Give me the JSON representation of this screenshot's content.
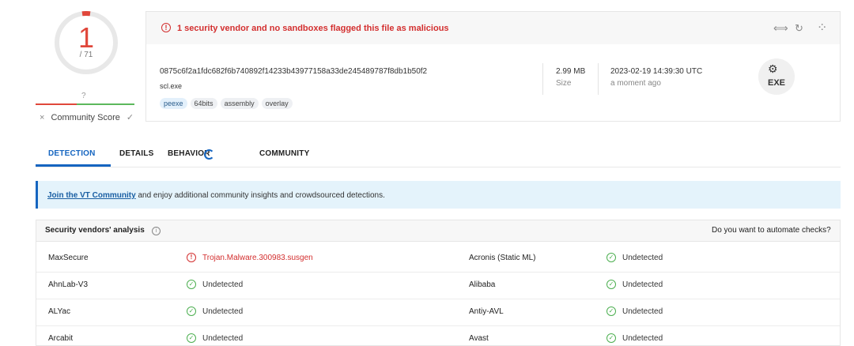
{
  "score": {
    "detections": "1",
    "total": "/ 71",
    "unknown": "?",
    "community_label": "Community Score",
    "x_icon": "×",
    "check_icon": "✓"
  },
  "alert": {
    "text": "1 security vendor and no sandboxes flagged this file as malicious",
    "icon": "!"
  },
  "toolbar": {
    "compare_icon": "⟺",
    "reanalyze_icon": "↻",
    "graph_icon": "⁘"
  },
  "file": {
    "hash": "0875c6f2a1fdc682f6b740892f14233b43977158a33de245489787f8db1b50f2",
    "name": "scl.exe",
    "tags": [
      "peexe",
      "64bits",
      "assembly",
      "overlay"
    ],
    "size_value": "2.99 MB",
    "size_label": "Size",
    "date_value": "2023-02-19 14:39:30 UTC",
    "date_label": "a moment ago",
    "type_icon_text": "EXE"
  },
  "tabs": [
    "DETECTION",
    "DETAILS",
    "BEHAVIOR",
    "COMMUNITY"
  ],
  "banner": {
    "link": "Join the VT Community",
    "text": " and enjoy additional community insights and crowdsourced detections."
  },
  "vendors": {
    "title": "Security vendors' analysis",
    "automate": "Do you want to automate checks?",
    "rows": [
      {
        "left": {
          "name": "MaxSecure",
          "result": "Trojan.Malware.300983.susgen",
          "status": "malicious"
        },
        "right": {
          "name": "Acronis (Static ML)",
          "result": "Undetected",
          "status": "clean"
        }
      },
      {
        "left": {
          "name": "AhnLab-V3",
          "result": "Undetected",
          "status": "clean"
        },
        "right": {
          "name": "Alibaba",
          "result": "Undetected",
          "status": "clean"
        }
      },
      {
        "left": {
          "name": "ALYac",
          "result": "Undetected",
          "status": "clean"
        },
        "right": {
          "name": "Antiy-AVL",
          "result": "Undetected",
          "status": "clean"
        }
      },
      {
        "left": {
          "name": "Arcabit",
          "result": "Undetected",
          "status": "clean"
        },
        "right": {
          "name": "Avast",
          "result": "Undetected",
          "status": "clean"
        }
      }
    ]
  },
  "colors": {
    "malicious": "#d32f2f",
    "clean": "#4caf50",
    "accent": "#1565c0"
  }
}
